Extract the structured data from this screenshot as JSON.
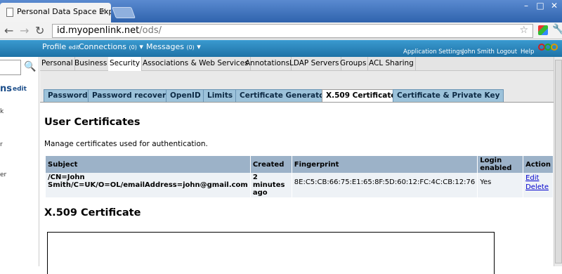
{
  "browser": {
    "tab_title": "Personal Data Space Exp",
    "tab_close": "✕",
    "url_host": "id.myopenlink.net",
    "url_path": "/ods/"
  },
  "ods_bar": {
    "profile": "Profile",
    "profile_edit": "edit",
    "connections": "Connections",
    "connections_count": "(0)",
    "messages": "Messages",
    "messages_count": "(0)",
    "app_settings": "Application Settings",
    "user_name": "John Smith",
    "logout": "Logout",
    "help": "Help"
  },
  "sidebar": {
    "title": "ns",
    "edit": "edit",
    "chars": [
      "k",
      "r",
      "er"
    ]
  },
  "section_tabs": [
    "Personal",
    "Business",
    "Security",
    "Associations & Web Services",
    "Annotations",
    "LDAP Servers",
    "Groups",
    "ACL Sharing"
  ],
  "sub_tabs": [
    "Password",
    "Password recovery",
    "OpenID",
    "Limits",
    "Certificate Generator",
    "X.509 Certificates",
    "Certificate & Private Key"
  ],
  "content": {
    "heading": "User Certificates",
    "description": "Manage certificates used for authentication.",
    "table": {
      "headers": [
        "Subject",
        "Created",
        "Fingerprint",
        "Login enabled",
        "Action"
      ],
      "rows": [
        {
          "subject": "/CN=John Smith/C=UK/O=OL/emailAddress=john@gmail.com",
          "created": "2 minutes ago",
          "fingerprint": "8E:C5:CB:66:75:E1:65:8F:5D:60:12:FC:4C:CB:12:76",
          "login_enabled": "Yes",
          "action_edit": "Edit",
          "action_delete": "Delete"
        }
      ]
    },
    "x509_heading": "X.509 Certificate"
  }
}
